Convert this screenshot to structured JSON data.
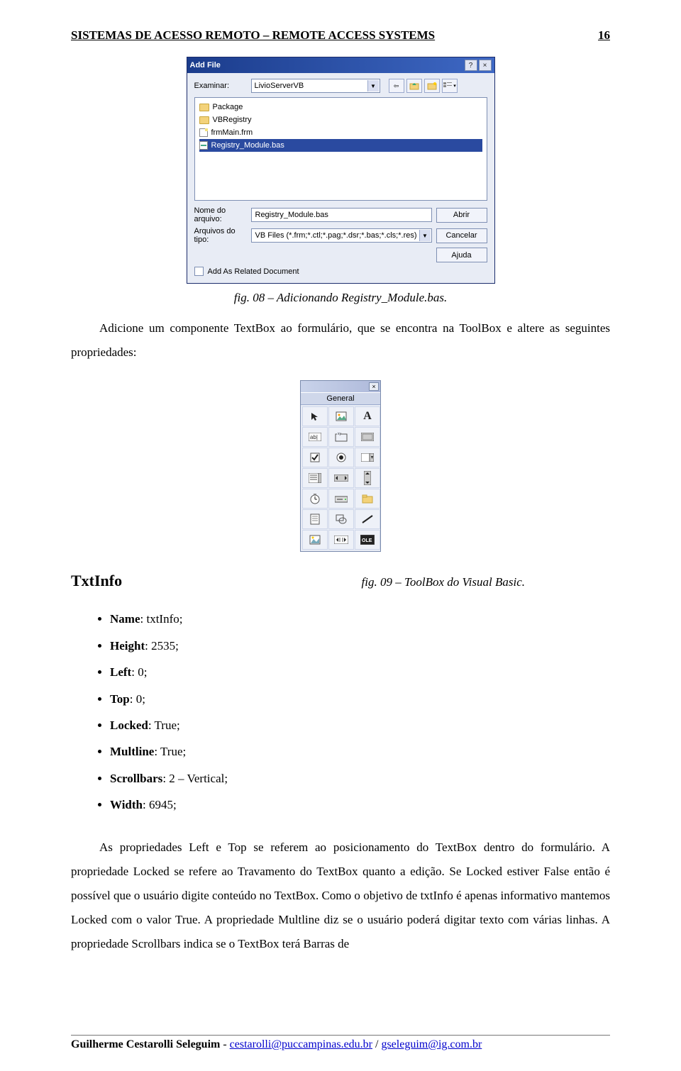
{
  "header": {
    "title": "SISTEMAS DE ACESSO REMOTO – REMOTE ACCESS SYSTEMS",
    "page_number": "16"
  },
  "dialog": {
    "title": "Add File",
    "help_glyph": "?",
    "close_glyph": "×",
    "examine_label": "Examinar:",
    "examine_value": "LivioServerVB",
    "file_list": [
      {
        "name": "Package",
        "type": "folder"
      },
      {
        "name": "VBRegistry",
        "type": "folder"
      },
      {
        "name": "frmMain.frm",
        "type": "frm"
      },
      {
        "name": "Registry_Module.bas",
        "type": "bas",
        "selected": true
      }
    ],
    "filename_label": "Nome do arquivo:",
    "filename_value": "Registry_Module.bas",
    "filetype_label": "Arquivos do tipo:",
    "filetype_value": "VB Files (*.frm;*.ctl;*.pag;*.dsr;*.bas;*.cls;*.res)",
    "open_label": "Abrir",
    "cancel_label": "Cancelar",
    "help_label": "Ajuda",
    "checkbox_label": "Add As Related Document",
    "toolbar_icons": {
      "back": "back-arrow-icon",
      "up": "up-folder-icon",
      "new": "new-folder-icon",
      "views": "list-views-icon"
    }
  },
  "caption1": "fig. 08 – Adicionando Registry_Module.bas.",
  "para1": "Adicione um componente TextBox ao formulário, que se encontra na ToolBox e altere as seguintes propriedades:",
  "toolbox": {
    "category": "General",
    "close_glyph": "×",
    "icons": [
      "pointer-icon",
      "picturebox-icon",
      "label-icon",
      "textbox-icon",
      "frame-icon",
      "commandbutton-icon",
      "checkbox-icon",
      "optionbutton-icon",
      "combobox-icon",
      "listbox-icon",
      "hscrollbar-icon",
      "vscrollbar-icon",
      "timer-icon",
      "drivelistbox-icon",
      "dirlistbox-icon",
      "filelistbox-icon",
      "shape-icon",
      "line-icon",
      "image-icon",
      "data-icon",
      "ole-icon"
    ]
  },
  "caption2": "fig. 09 – ToolBox do Visual Basic.",
  "section_heading": "TxtInfo",
  "properties": [
    {
      "key": "Name",
      "val": "txtInfo;"
    },
    {
      "key": "Height",
      "val": "2535;"
    },
    {
      "key": "Left",
      "val": "0;"
    },
    {
      "key": "Top",
      "val": "0;"
    },
    {
      "key": "Locked",
      "val": "True;"
    },
    {
      "key": "Multline",
      "val": "True;"
    },
    {
      "key": "Scrollbars",
      "val": "2 – Vertical;"
    },
    {
      "key": "Width",
      "val": "6945;"
    }
  ],
  "para2": "As propriedades Left e Top se referem ao posicionamento do TextBox dentro do formulário. A propriedade Locked se refere ao Travamento do TextBox quanto a edição. Se Locked estiver False então é possível que o usuário digite conteúdo no TextBox. Como o objetivo de txtInfo é apenas informativo mantemos Locked com o valor True. A propriedade Multline diz se o usuário poderá digitar texto com várias linhas. A propriedade Scrollbars indica se o TextBox terá Barras de",
  "footer": {
    "author": "Guilherme Cestarolli Seleguim",
    "sep": " - ",
    "email1": "cestarolli@puccampinas.edu.br",
    "sep2": " / ",
    "email2": "gseleguim@ig.com.br"
  }
}
